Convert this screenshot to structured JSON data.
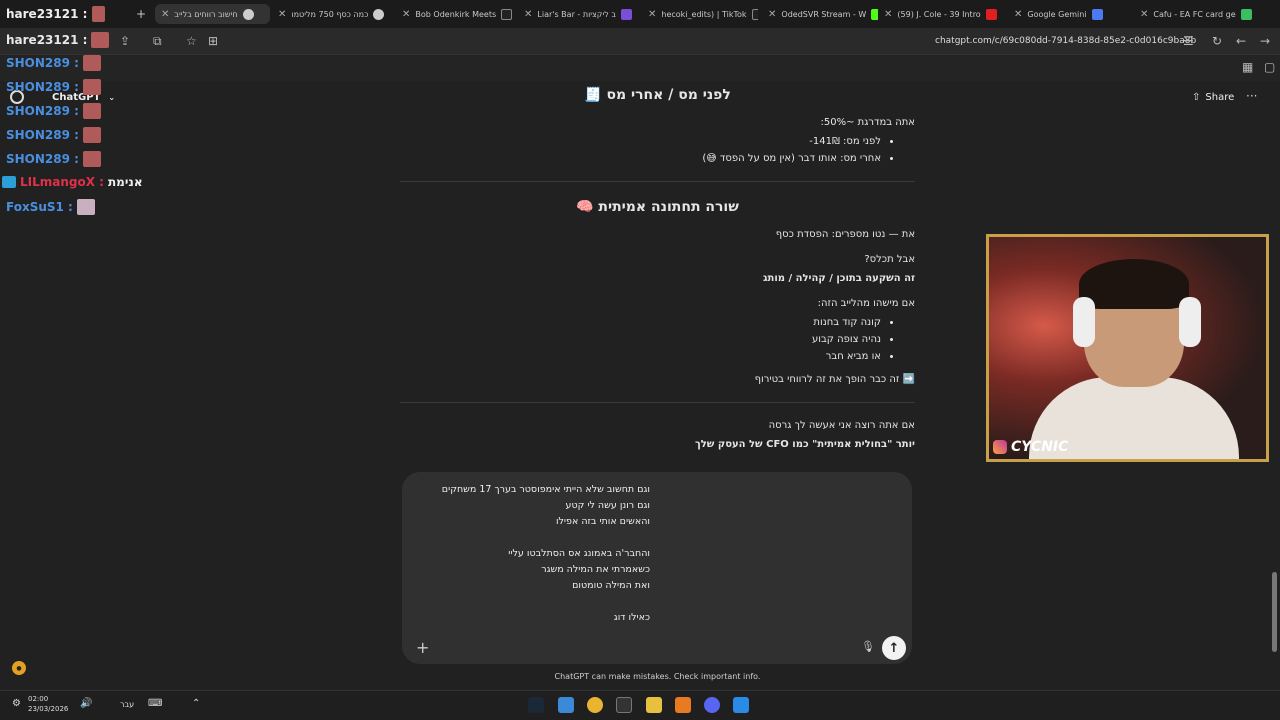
{
  "browser": {
    "tabs": [
      {
        "label": "hare23121 :",
        "x": 0
      },
      {
        "label": "חישוב רווחים בלייב",
        "active": true
      },
      {
        "label": "כמה כסף 750 מליטמו"
      },
      {
        "label": "Bob Odenkirk Meets"
      },
      {
        "label": "Liar's Bar - ב ליקציות"
      },
      {
        "label": "hecoki_edits) | TikTok"
      },
      {
        "label": "OdedSVR Stream - W"
      },
      {
        "label": "(59) J. Cole - 39 Intro"
      },
      {
        "label": "Google Gemini"
      },
      {
        "label": "Cafu - EA FC card ge"
      }
    ],
    "new_tab": "+",
    "url": "chatgpt.com/c/69c080dd-7914-838d-85e2-c0d016c9ba8b"
  },
  "stream_overlay": {
    "chat_lines": [
      {
        "user": "hare23121 :",
        "color": "#e8e8e8"
      },
      {
        "user": "SHON289 :",
        "color": "#4a8fe0"
      },
      {
        "user": "SHON289 :",
        "color": "#4a8fe0"
      },
      {
        "user": "SHON289 :",
        "color": "#4a8fe0"
      },
      {
        "user": "SHON289 :",
        "color": "#4a8fe0"
      },
      {
        "user": "SHON289 :",
        "color": "#4a8fe0"
      },
      {
        "user": "LILmangoX :",
        "color": "#e0304a",
        "msg": "אנימת"
      },
      {
        "user": "FoxSuS1 :",
        "color": "#4a8fe0"
      }
    ],
    "webcam_name": "CYCNIC"
  },
  "app": {
    "name": "ChatGPT",
    "share": "Share",
    "more": "···"
  },
  "conversation": {
    "section1_title": "לפני מס / אחרי מס 🧾",
    "section1_intro": "אתה במדרגת ~50%:",
    "section1_items": [
      "לפני מס: 141₪-",
      "אחרי מס: אותו דבר (אין מס על הפסד 😅)"
    ],
    "section2_title": "שורה תחתונה אמיתית 🧠",
    "section2_line1": "את — נטו מספרים: הפסדת כסף",
    "section2_q": "אבל תכלס?",
    "section2_bold": "זה השקעה בתוכן / קהילה / מותג",
    "section2_if": "אם מישהו מהלייב הזה:",
    "section2_items": [
      "קונה קוד בחנות",
      "נהיה צופה קבוע",
      "או מביא חבר"
    ],
    "section2_arrow": "➡️ זה כבר הופך את זה לרווחי בטירוף",
    "section3_line": "אם אתה רוצה אני אעשה לך גרסה",
    "section3_partial": "יותר \"בחולית אמיתית\" כמו CFO של העסק שלך"
  },
  "composer": {
    "text": "וגם תחשוב שלא הייתי אימפוסטר בערך 17 משחקים\nוגם רונן עשה לי קטע\nוהאשים אותי בזה אפילו\n\nוהחבר'ה באמונג אס הסתלבטו עליי\nכשאמרתי את המילה משגר\nואת המילה טומטום\n\nכאילו דוג",
    "plus": "+",
    "send": "↑"
  },
  "disclaimer": "ChatGPT can make mistakes. Check important info.",
  "taskbar": {
    "time": "02:00",
    "date": "23/03/2026",
    "lang": "עבר"
  }
}
